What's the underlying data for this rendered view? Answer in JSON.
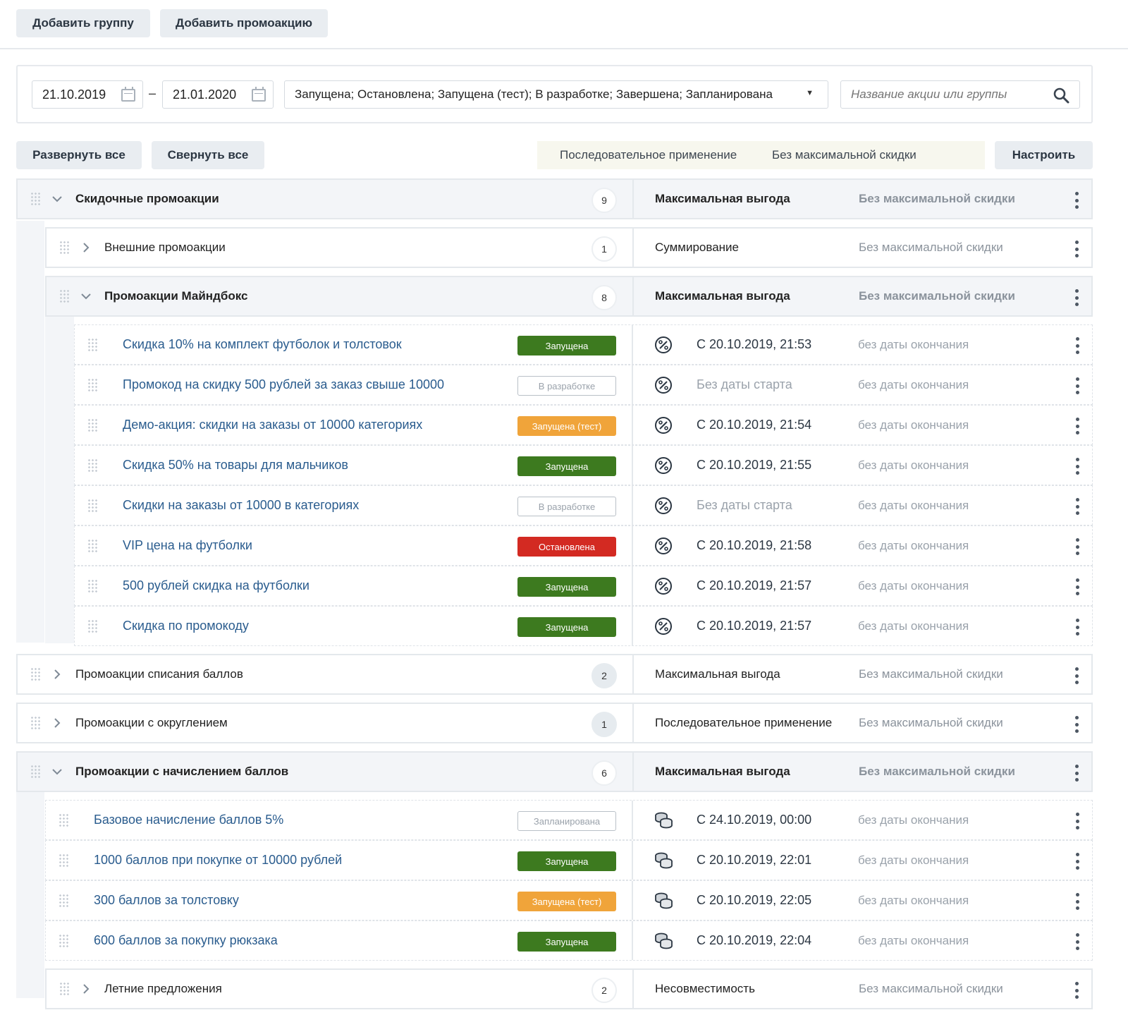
{
  "toolbar": {
    "add_group": "Добавить группу",
    "add_promo": "Добавить промоакцию"
  },
  "filters": {
    "date_from": "21.10.2019",
    "date_to": "21.01.2020",
    "date_separator": "–",
    "statuses": "Запущена; Остановлена; Запущена (тест); В разработке; Завершена; Запланирована",
    "search_placeholder": "Название акции или группы"
  },
  "controls": {
    "expand_all": "Развернуть все",
    "collapse_all": "Свернуть все",
    "root_mode": "Последовательное применение",
    "root_limit": "Без максимальной скидки",
    "configure": "Настроить"
  },
  "rows": [
    {
      "kind": "group",
      "level": 0,
      "expanded": true,
      "title": "Скидочные промоакции",
      "count": "9",
      "mode": "Максимальная выгода",
      "limit": "Без максимальной скидки"
    },
    {
      "kind": "group",
      "level": 1,
      "expanded": false,
      "title": "Внешние промоакции",
      "count": "1",
      "mode": "Суммирование",
      "limit": "Без максимальной скидки"
    },
    {
      "kind": "group",
      "level": 1,
      "expanded": true,
      "title": "Промоакции Майндбокс",
      "count": "8",
      "mode": "Максимальная выгода",
      "limit": "Без максимальной скидки"
    },
    {
      "kind": "promo",
      "level": 2,
      "type": "discount",
      "title": "Скидка 10% на комплект футболок и толстовок",
      "status": "Запущена",
      "status_style": "green",
      "start": "С 20.10.2019, 21:53",
      "end": "без даты окончания"
    },
    {
      "kind": "promo",
      "level": 2,
      "type": "discount",
      "title": "Промокод на скидку 500 рублей за заказ свыше 10000",
      "status": "В разработке",
      "status_style": "outline",
      "start": "Без даты старта",
      "end": "без даты окончания"
    },
    {
      "kind": "promo",
      "level": 2,
      "type": "discount",
      "title": "Демо-акция: скидки на заказы от 10000 категориях",
      "status": "Запущена (тест)",
      "status_style": "orange",
      "start": "С 20.10.2019, 21:54",
      "end": "без даты окончания"
    },
    {
      "kind": "promo",
      "level": 2,
      "type": "discount",
      "title": "Скидка 50% на товары для мальчиков",
      "status": "Запущена",
      "status_style": "green",
      "start": "С 20.10.2019, 21:55",
      "end": "без даты окончания"
    },
    {
      "kind": "promo",
      "level": 2,
      "type": "discount",
      "title": "Скидки на заказы от 10000 в категориях",
      "status": "В разработке",
      "status_style": "outline",
      "start": "Без даты старта",
      "end": "без даты окончания"
    },
    {
      "kind": "promo",
      "level": 2,
      "type": "discount",
      "title": "VIP цена на футболки",
      "status": "Остановлена",
      "status_style": "red",
      "start": "С 20.10.2019, 21:58",
      "end": "без даты окончания"
    },
    {
      "kind": "promo",
      "level": 2,
      "type": "discount",
      "title": "500 рублей скидка на футболки",
      "status": "Запущена",
      "status_style": "green",
      "start": "С 20.10.2019, 21:57",
      "end": "без даты окончания"
    },
    {
      "kind": "promo",
      "level": 2,
      "type": "discount",
      "title": "Скидка по промокоду",
      "status": "Запущена",
      "status_style": "green",
      "start": "С 20.10.2019, 21:57",
      "end": "без даты окончания"
    },
    {
      "kind": "group",
      "level": 0,
      "expanded": false,
      "title": "Промоакции списания баллов",
      "count": "2",
      "mode": "Максимальная выгода",
      "limit": "Без максимальной скидки"
    },
    {
      "kind": "group",
      "level": 0,
      "expanded": false,
      "title": "Промоакции с округлением",
      "count": "1",
      "mode": "Последовательное применение",
      "limit": "Без максимальной скидки"
    },
    {
      "kind": "group",
      "level": 0,
      "expanded": true,
      "title": "Промоакции с начислением баллов",
      "count": "6",
      "mode": "Максимальная выгода",
      "limit": "Без максимальной скидки"
    },
    {
      "kind": "promo",
      "level": 1,
      "type": "points",
      "title": "Базовое начисление баллов 5%",
      "status": "Запланирована",
      "status_style": "outline",
      "start": "С 24.10.2019, 00:00",
      "end": "без даты окончания"
    },
    {
      "kind": "promo",
      "level": 1,
      "type": "points",
      "title": "1000 баллов при покупке от 10000 рублей",
      "status": "Запущена",
      "status_style": "green",
      "start": "С 20.10.2019, 22:01",
      "end": "без даты окончания"
    },
    {
      "kind": "promo",
      "level": 1,
      "type": "points",
      "title": "300 баллов за толстовку",
      "status": "Запущена (тест)",
      "status_style": "orange",
      "start": "С 20.10.2019, 22:05",
      "end": "без даты окончания"
    },
    {
      "kind": "promo",
      "level": 1,
      "type": "points",
      "title": "600 баллов за покупку рюкзака",
      "status": "Запущена",
      "status_style": "green",
      "start": "С 20.10.2019, 22:04",
      "end": "без даты окончания"
    },
    {
      "kind": "group",
      "level": 1,
      "expanded": false,
      "title": "Летние предложения",
      "count": "2",
      "mode": "Несовместимость",
      "limit": "Без максимальной скидки"
    }
  ],
  "icons": {
    "discount": "percent-circle-icon",
    "points": "coins-stack-icon",
    "search": "search-icon",
    "calendar": "calendar-icon",
    "menu": "kebab-menu-icon"
  }
}
